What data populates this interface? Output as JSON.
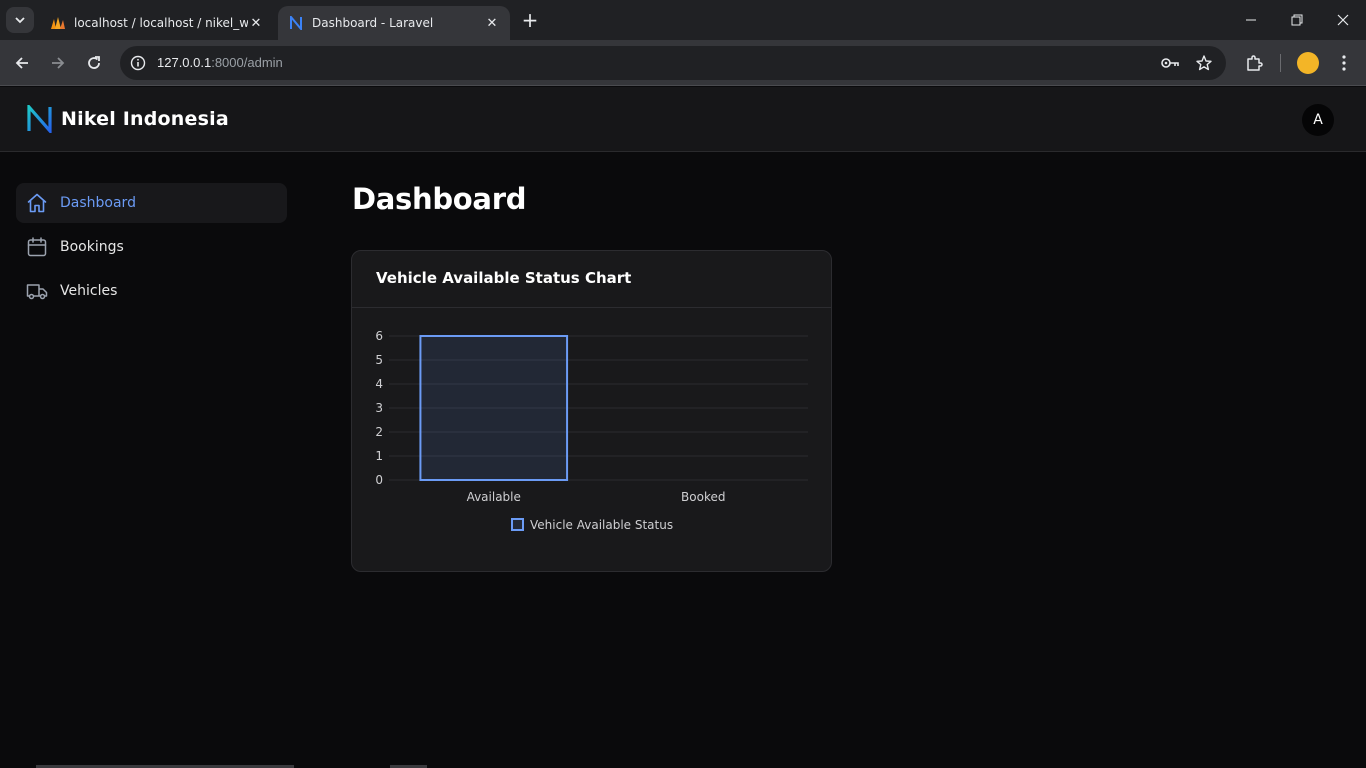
{
  "browser": {
    "tabs": [
      {
        "title": "localhost / localhost / nikel_web",
        "active": false
      },
      {
        "title": "Dashboard - Laravel",
        "active": true
      }
    ],
    "url_host": "127.0.0.1",
    "url_path": ":8000/admin"
  },
  "app": {
    "brand": "Nikel Indonesia",
    "avatar_initial": "A",
    "accent_color": "#6b9bf5"
  },
  "sidebar": {
    "items": [
      {
        "label": "Dashboard",
        "icon": "home-icon",
        "active": true
      },
      {
        "label": "Bookings",
        "icon": "calendar-icon",
        "active": false
      },
      {
        "label": "Vehicles",
        "icon": "truck-icon",
        "active": false
      }
    ]
  },
  "main": {
    "title": "Dashboard",
    "card_title": "Vehicle Available Status Chart"
  },
  "chart_data": {
    "type": "bar",
    "categories": [
      "Available",
      "Booked"
    ],
    "series": [
      {
        "name": "Vehicle Available Status",
        "values": [
          6,
          0
        ],
        "color": "#6b9bf5"
      }
    ],
    "ylim": [
      0,
      6
    ],
    "yticks": [
      0,
      1,
      2,
      3,
      4,
      5,
      6
    ],
    "grid": true,
    "legend": "bottom"
  }
}
